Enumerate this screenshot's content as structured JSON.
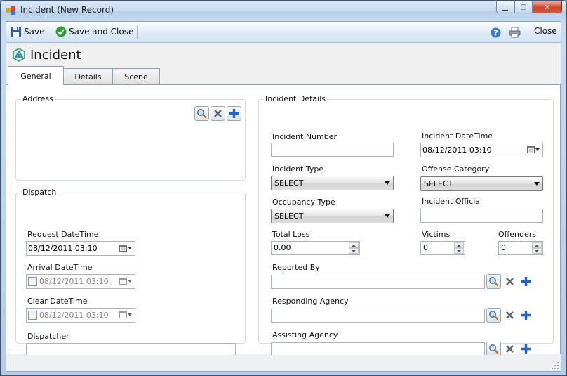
{
  "window": {
    "title": "Incident (New Record)",
    "minimize_label": "▁",
    "maximize_label": "▢",
    "close_label": "✕"
  },
  "toolbar": {
    "save_label": "Save",
    "save_close_label": "Save and Close",
    "close_label": "Close"
  },
  "header": {
    "title": "Incident"
  },
  "tabs": [
    {
      "label": "General",
      "active": true
    },
    {
      "label": "Details",
      "active": false
    },
    {
      "label": "Scene",
      "active": false
    }
  ],
  "address": {
    "title": "Address"
  },
  "dispatch": {
    "title": "Dispatch",
    "request_label": "Request DateTime",
    "request_value": "08/12/2011 03:10",
    "arrival_label": "Arrival DateTime",
    "arrival_value": "08/12/2011 03:10",
    "clear_label": "Clear DateTime",
    "clear_value": "08/12/2011 03:10",
    "dispatcher_label": "Dispatcher",
    "dispatcher_value": ""
  },
  "incident": {
    "title": "Incident Details",
    "number_label": "Incident Number",
    "number_value": "",
    "datetime_label": "Incident DateTime",
    "datetime_value": "08/12/2011 03:10",
    "type_label": "Incident Type",
    "type_value": "SELECT",
    "offense_label": "Offense Category",
    "offense_value": "SELECT",
    "occupancy_label": "Occupancy Type",
    "occupancy_value": "SELECT",
    "official_label": "Incident Official",
    "official_value": "",
    "loss_label": "Total Loss",
    "loss_value": "0.00",
    "victims_label": "Victims",
    "victims_value": "0",
    "offenders_label": "Offenders",
    "offenders_value": "0",
    "reported_label": "Reported By",
    "reported_value": "",
    "responding_label": "Responding Agency",
    "responding_value": "",
    "assisting_label": "Assisting Agency",
    "assisting_value": ""
  },
  "colors": {
    "plus_blue": "#1d63d8",
    "x_gray": "#5c6670",
    "save_green": "#2aa336"
  }
}
